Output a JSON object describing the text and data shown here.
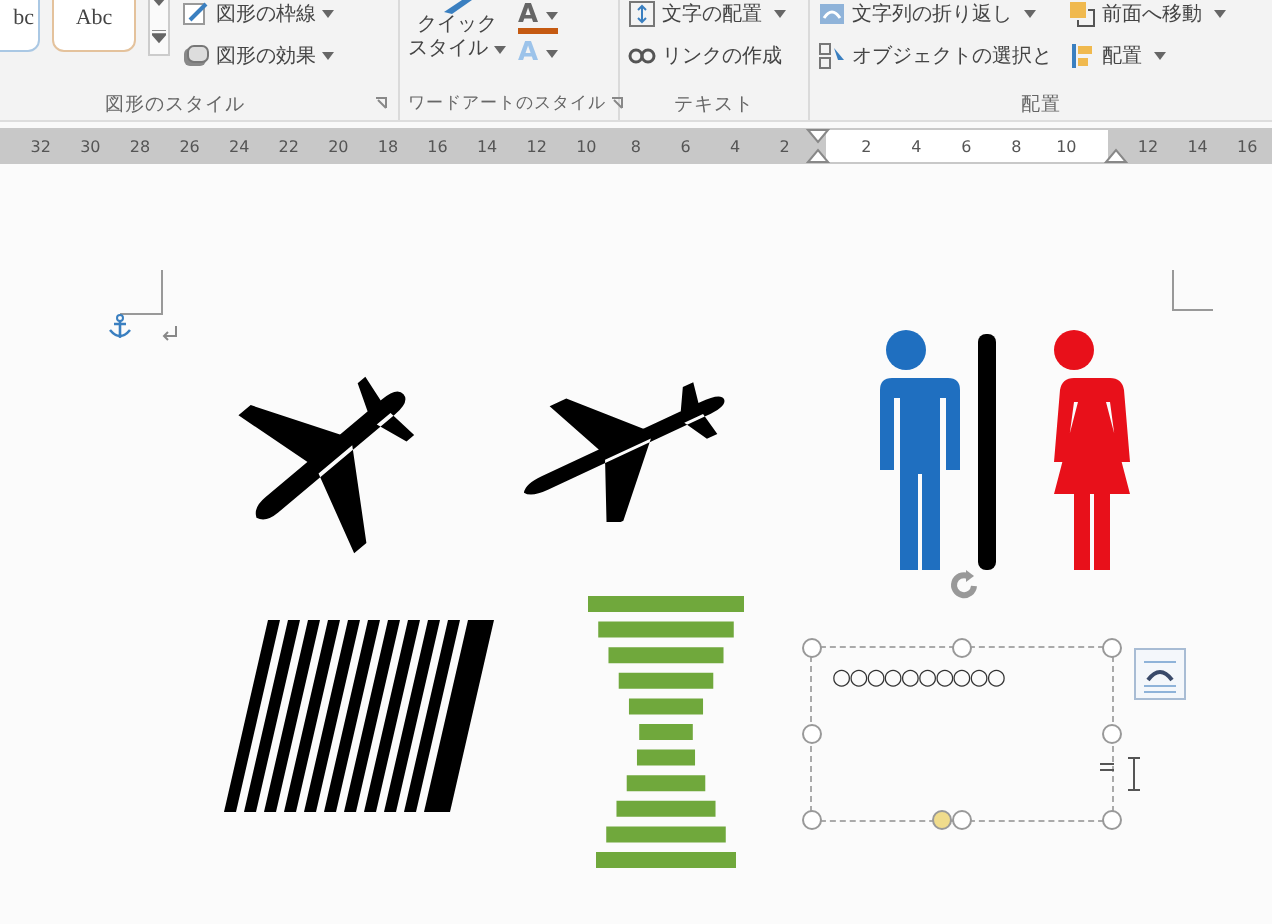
{
  "ribbon": {
    "groups": [
      {
        "kind": "gallery",
        "label": "図形のスタイル",
        "tiles": [
          "bc",
          "Abc"
        ],
        "commands": [
          {
            "text": "図形の枠線"
          },
          {
            "text": "図形の効果"
          }
        ]
      },
      {
        "kind": "wordart",
        "label": "ワードアートのスタイル",
        "quick": [
          "クイック",
          "スタイル"
        ],
        "letters": [
          "A",
          "A"
        ]
      },
      {
        "kind": "commands",
        "label": "テキスト",
        "commands": [
          {
            "text": "文字の配置",
            "dropdown": true
          },
          {
            "text": "リンクの作成",
            "dropdown": false
          }
        ]
      },
      {
        "kind": "arrange",
        "label": "配置",
        "commands": [
          {
            "text": "文字列の折り返し",
            "dropdown": true
          },
          {
            "text": "オブジェクトの選択と",
            "dropdown": false
          },
          {
            "text": "前面へ移動",
            "dropdown": true
          },
          {
            "text": "配置",
            "dropdown": true
          }
        ]
      }
    ]
  },
  "ruler": {
    "left_numbers": [
      "32",
      "30",
      "28",
      "26",
      "24",
      "22",
      "20",
      "18",
      "16",
      "14",
      "12",
      "10",
      "8",
      "6",
      "4",
      "2"
    ],
    "text_numbers": [
      "2",
      "4",
      "6",
      "8",
      "10"
    ],
    "right_numbers": [
      "12",
      "14",
      "16"
    ]
  },
  "document": {
    "text_box": {
      "text": "○○○○○○○○○○",
      "selected": true
    }
  }
}
